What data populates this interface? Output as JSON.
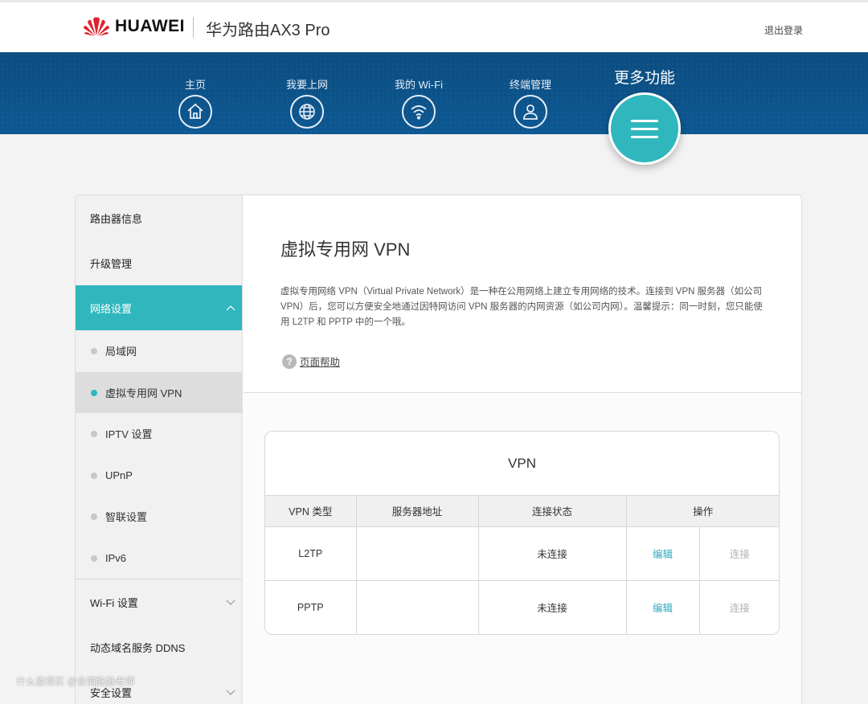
{
  "brand": {
    "name": "HUAWEI",
    "product": "华为路由AX3 Pro",
    "logout": "退出登录",
    "logo_color": "#e0212e"
  },
  "nav": {
    "items": [
      {
        "label": "主页",
        "icon": "home-icon"
      },
      {
        "label": "我要上网",
        "icon": "globe-icon"
      },
      {
        "label": "我的 Wi-Fi",
        "icon": "wifi-icon"
      },
      {
        "label": "终端管理",
        "icon": "user-icon"
      }
    ],
    "more": {
      "label": "更多功能",
      "icon": "menu-icon"
    },
    "band_color": "#0d5893",
    "accent": "#2fb7bd"
  },
  "sidebar": {
    "top_items": [
      "路由器信息",
      "升级管理"
    ],
    "network": {
      "label": "网络设置",
      "sub": [
        "局域网",
        "虚拟专用网 VPN",
        "IPTV 设置",
        "UPnP",
        "智联设置",
        "IPv6"
      ],
      "current_index": 1
    },
    "bottom": {
      "wifi": "Wi-Fi 设置",
      "ddns": "动态域名服务 DDNS",
      "security": "安全设置"
    }
  },
  "content": {
    "title": "虚拟专用网 VPN",
    "description": "虚拟专用网络 VPN（Virtual Private Network）是一种在公用网络上建立专用网络的技术。连接到 VPN 服务器（如公司 VPN）后，您可以方便安全地通过因特网访问 VPN 服务器的内网资源（如公司内网）。温馨提示：同一时刻，您只能使用 L2TP 和 PPTP 中的一个哦。",
    "help": {
      "icon": "?",
      "label": "页面帮助"
    }
  },
  "vpn_table": {
    "title": "VPN",
    "headers": {
      "type": "VPN 类型",
      "server": "服务器地址",
      "status": "连接状态",
      "action": "操作"
    },
    "rows": [
      {
        "type": "L2TP",
        "server": "",
        "status": "未连接",
        "edit": "编辑",
        "connect": "连接"
      },
      {
        "type": "PPTP",
        "server": "",
        "status": "未连接",
        "edit": "编辑",
        "connect": "连接"
      }
    ]
  },
  "watermark": "什么值得买 @含情脉脉老师"
}
